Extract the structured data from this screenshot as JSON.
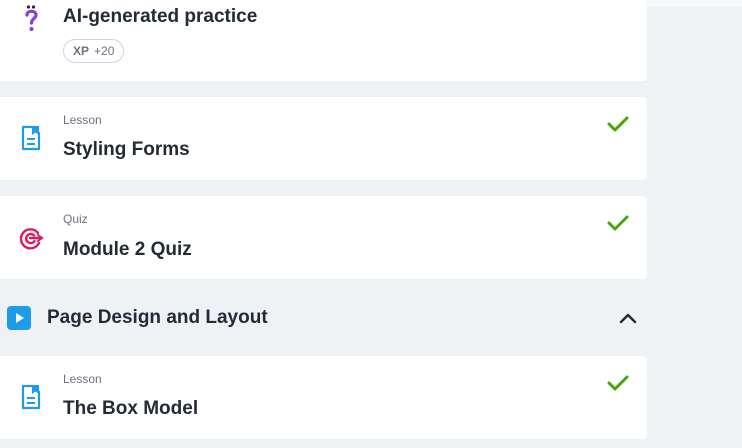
{
  "items": [
    {
      "kind": "practice",
      "title": "AI-generated practice",
      "xp_label": "XP",
      "xp_value": "+20",
      "icon": "question-mark-icon",
      "completed": false
    },
    {
      "kind": "lesson",
      "type_label": "Lesson",
      "title": "Styling Forms",
      "icon": "document-icon",
      "completed": true
    },
    {
      "kind": "quiz",
      "type_label": "Quiz",
      "title": "Module 2 Quiz",
      "icon": "target-icon",
      "completed": true
    }
  ],
  "section": {
    "title": "Page Design and Layout",
    "icon": "play-icon",
    "toggle_icon": "chevron-up-icon",
    "expanded": true,
    "items": [
      {
        "kind": "lesson",
        "type_label": "Lesson",
        "title": "The Box Model",
        "icon": "document-icon",
        "completed": true
      }
    ]
  },
  "colors": {
    "background": "#eff2f5",
    "card": "#ffffff",
    "check": "#43a80b",
    "lesson_icon": "#1e9ce8",
    "quiz_icon": "#e0195a",
    "practice_icon": "#8a3ee0",
    "section_icon": "#1e9ce8",
    "title_text": "#232b36",
    "muted_text": "#6b7380"
  }
}
